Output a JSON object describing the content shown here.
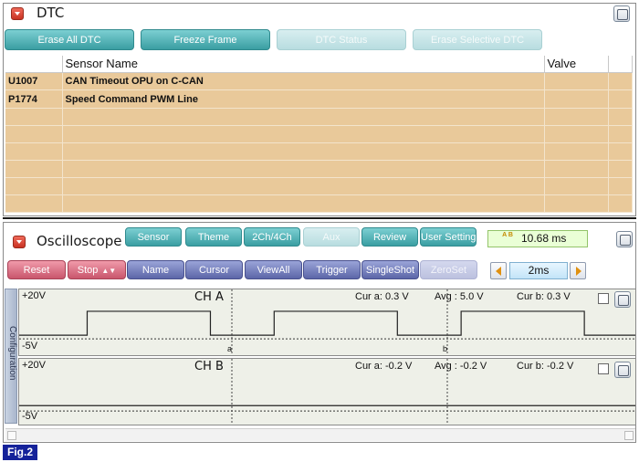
{
  "dtc": {
    "title": "DTC",
    "buttons": [
      {
        "label": "Erase All DTC",
        "enabled": true
      },
      {
        "label": "Freeze Frame",
        "enabled": true
      },
      {
        "label": "DTC Status",
        "enabled": false
      },
      {
        "label": "Erase Selective DTC",
        "enabled": false
      }
    ],
    "columns": [
      "",
      "Sensor Name",
      "Valve"
    ],
    "rows": [
      {
        "code": "U1007",
        "name": "CAN Timeout OPU on C-CAN",
        "valve": ""
      },
      {
        "code": "P1774",
        "name": "Speed Command PWM Line",
        "valve": ""
      }
    ]
  },
  "oscilloscope": {
    "title": "Oscilloscope",
    "top_buttons": [
      {
        "label": "Sensor",
        "enabled": true
      },
      {
        "label": "Theme",
        "enabled": true
      },
      {
        "label": "2Ch/4Ch",
        "enabled": true
      },
      {
        "label": "Aux",
        "enabled": false
      },
      {
        "label": "Review",
        "enabled": true
      },
      {
        "label": "User Setting",
        "enabled": true
      }
    ],
    "time_display": "10.68 ms",
    "time_icon_text": "A B",
    "bottom_buttons": [
      {
        "label": "Reset",
        "style": "pink",
        "enabled": true
      },
      {
        "label": "Stop",
        "style": "pink",
        "enabled": true
      },
      {
        "label": "Name",
        "style": "slate",
        "enabled": true
      },
      {
        "label": "Cursor",
        "style": "slate",
        "enabled": true
      },
      {
        "label": "ViewAll",
        "style": "slate",
        "enabled": true
      },
      {
        "label": "Trigger",
        "style": "slate",
        "enabled": true
      },
      {
        "label": "SingleShot",
        "style": "slate",
        "enabled": true
      },
      {
        "label": "ZeroSet",
        "style": "slate",
        "enabled": false
      }
    ],
    "time_scale": "2ms",
    "side_tab_label": "Configuration",
    "channels": [
      {
        "name": "CH A",
        "y_max_label": "+20V",
        "y_min_label": "-5V",
        "cur_a": "Cur a: 0.3 V",
        "avg": "Avg : 5.0 V",
        "cur_b": "Cur b: 0.3 V",
        "cursor_a_label": "a",
        "cursor_b_label": "b",
        "waveform": {
          "type": "pwm",
          "low_v": 0.3,
          "high_v": 12.0,
          "pulses_ms": [
            [
              1.6,
              4.5
            ],
            [
              6.0,
              8.9
            ],
            [
              10.4,
              13.3
            ]
          ]
        }
      },
      {
        "name": "CH B",
        "y_max_label": "+20V",
        "y_min_label": "-5V",
        "cur_a": "Cur a: -0.2 V",
        "avg": "Avg : -0.2 V",
        "cur_b": "Cur b: -0.2 V",
        "waveform": {
          "type": "flat",
          "level_v": -0.2
        }
      }
    ]
  },
  "figure_label": "Fig.2",
  "colors": {
    "teal": "#3a9ea2",
    "pink": "#c9566c",
    "slate": "#5c66a8",
    "dtc_row": "#e9c99a",
    "fig_label_bg": "#15229a"
  }
}
